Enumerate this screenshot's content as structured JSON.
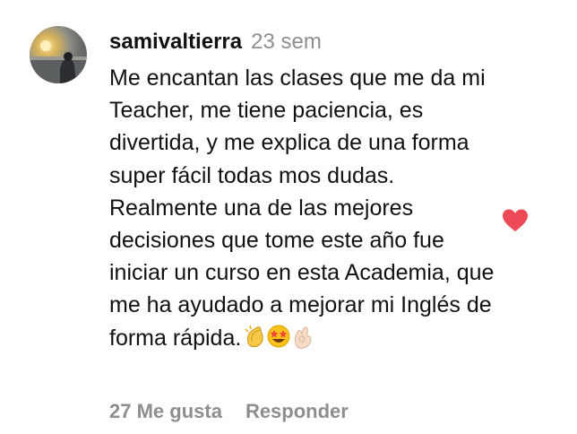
{
  "comment": {
    "username": "samivaltierra",
    "time": "23 sem",
    "text": "Me encantan las clases que me da mi Teacher, me tiene paciencia, es divertida, y me explica de una forma super fácil todas mos dudas. Realmente una de las mejores decisiones que tome este año fue iniciar un curso en esta Academia, que me ha ayudado a mejorar mi Inglés de forma rápida.",
    "emojis": [
      "clapping-hands",
      "star-struck",
      "ok-hand"
    ]
  },
  "actions": {
    "likes_label": "27 Me gusta",
    "reply_label": "Responder"
  },
  "colors": {
    "heart": "#ed4956",
    "secondary_text": "#8e8e8e"
  },
  "icons": {
    "like": "heart-icon"
  }
}
